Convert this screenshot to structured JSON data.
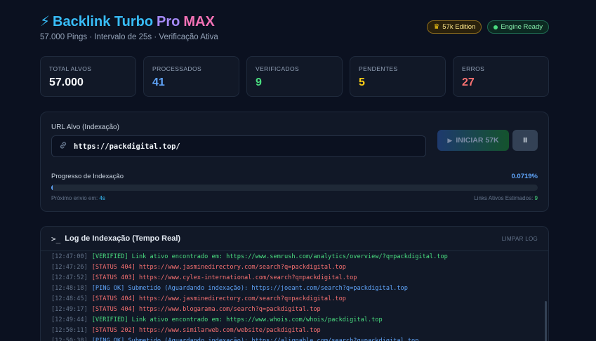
{
  "header": {
    "title_part1": "Backlink Turbo",
    "title_part2": "Pro",
    "title_part3": "MAX",
    "subtitle": "57.000 Pings · Intervalo de 25s · Verificação Ativa",
    "badge_edition": "57k Edition",
    "badge_status": "Engine Ready"
  },
  "stats": [
    {
      "label": "TOTAL ALVOS",
      "value": "57.000",
      "color": "#f8fafc"
    },
    {
      "label": "PROCESSADOS",
      "value": "41",
      "color": "#60a5fa"
    },
    {
      "label": "VERIFICADOS",
      "value": "9",
      "color": "#4ade80"
    },
    {
      "label": "PENDENTES",
      "value": "5",
      "color": "#facc15"
    },
    {
      "label": "ERROS",
      "value": "27",
      "color": "#f87171"
    }
  ],
  "control": {
    "url_label": "URL Alvo (Indexação)",
    "url_value": "https://packdigital.top/",
    "start_label": "INICIAR 57K",
    "pause_label": "II",
    "progress_label": "Progresso de Indexação",
    "progress_pct": "0.0719%",
    "progress_fraction": 0.000719,
    "next_send_label": "Próximo envio em:",
    "next_send_value": "4s",
    "links_est_label": "Links Ativos Estimados:",
    "links_est_value": "9"
  },
  "log": {
    "title": "Log de Indexação (Tempo Real)",
    "clear_label": "LIMPAR LOG",
    "entries": [
      {
        "time": "[12:47:00]",
        "text": "[VERIFIED] Link ativo encontrado em: https://www.semrush.com/analytics/overview/?q=packdigital.top",
        "color": "#4ade80"
      },
      {
        "time": "[12:47:26]",
        "text": "[STATUS 404] https://www.jasminedirectory.com/search?q=packdigital.top",
        "color": "#f87171"
      },
      {
        "time": "[12:47:52]",
        "text": "[STATUS 403] https://www.cylex-international.com/search?q=packdigital.top",
        "color": "#f87171"
      },
      {
        "time": "[12:48:18]",
        "text": "[PING OK] Submetido (Aguardando indexação): https://joeant.com/search?q=packdigital.top",
        "color": "#60a5fa"
      },
      {
        "time": "[12:48:45]",
        "text": "[STATUS 404] https://www.jasminedirectory.com/search?q=packdigital.top",
        "color": "#f87171"
      },
      {
        "time": "[12:49:17]",
        "text": "[STATUS 404] https://www.blogarama.com/search?q=packdigital.top",
        "color": "#f87171"
      },
      {
        "time": "[12:49:44]",
        "text": "[VERIFIED] Link ativo encontrado em: https://www.whois.com/whois/packdigital.top",
        "color": "#4ade80"
      },
      {
        "time": "[12:50:11]",
        "text": "[STATUS 202] https://www.similarweb.com/website/packdigital.top",
        "color": "#f87171"
      },
      {
        "time": "[12:50:38]",
        "text": "[PING OK] Submetido (Aguardando indexação): https://alignable.com/search?q=packdigital.top",
        "color": "#60a5fa"
      }
    ]
  },
  "icons": {
    "bolt": "⚡",
    "crown": "♛",
    "link": "⊘",
    "play": "▶",
    "terminal": ">_"
  }
}
